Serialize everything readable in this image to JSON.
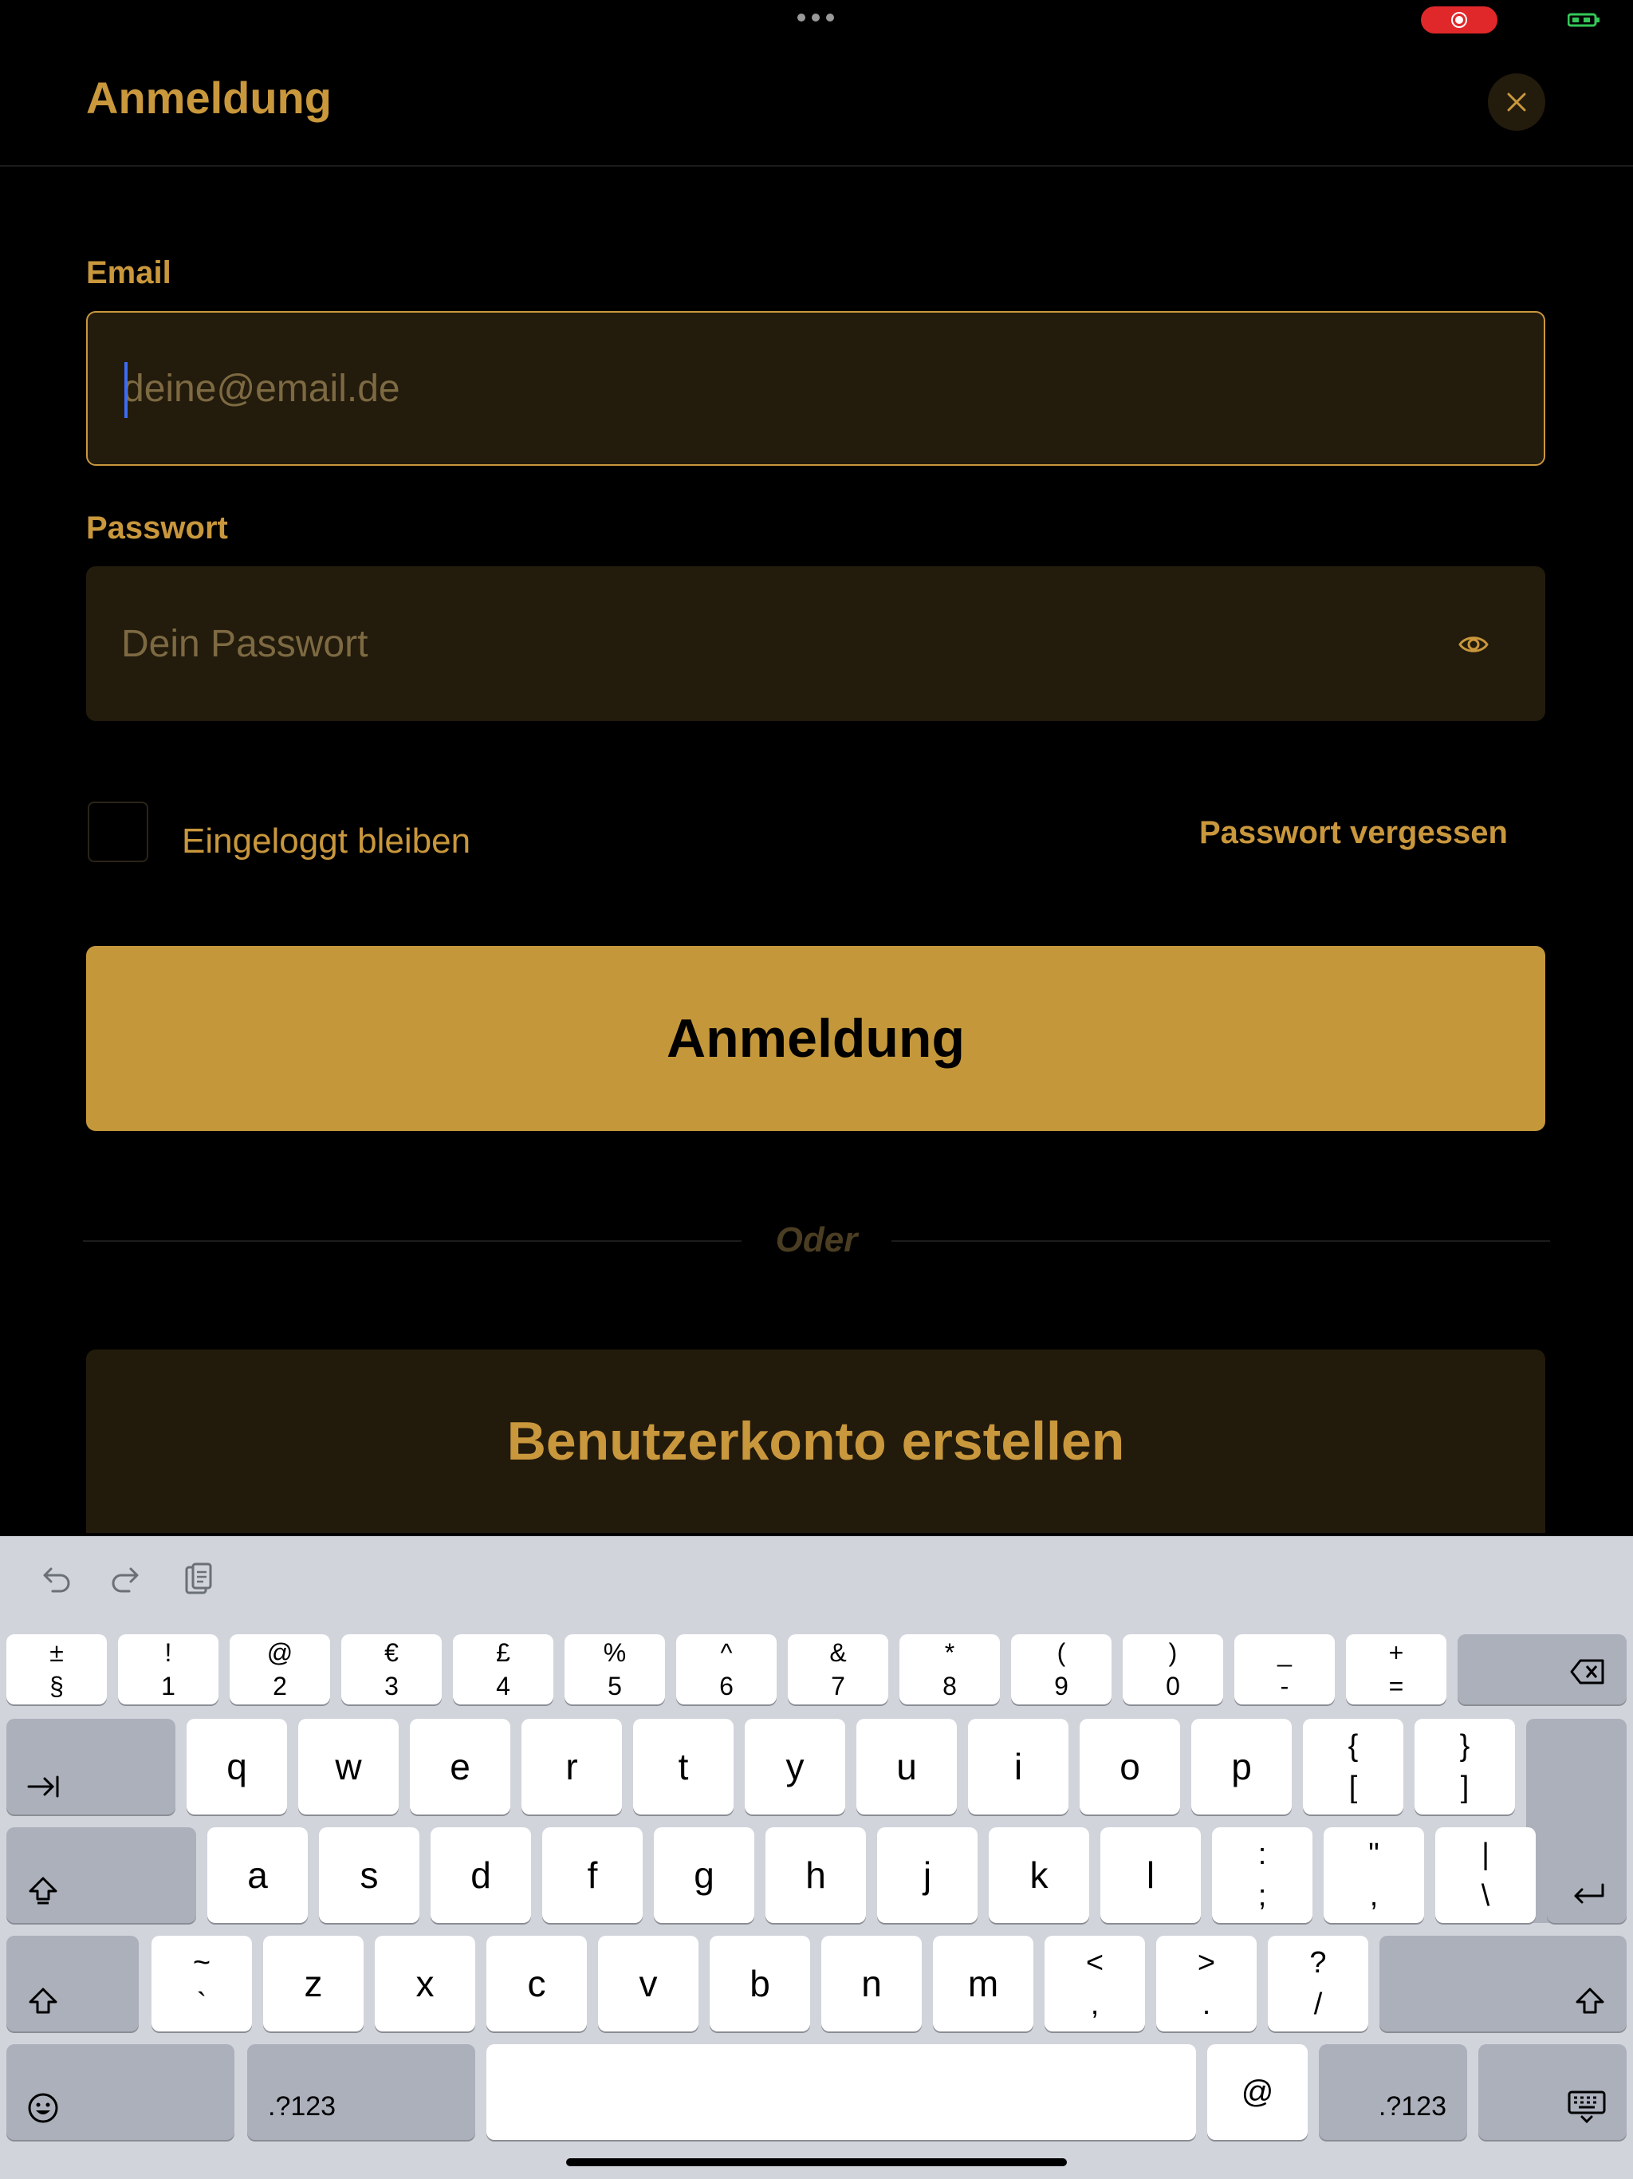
{
  "header": {
    "title": "Anmeldung"
  },
  "form": {
    "email_label": "Email",
    "email_placeholder": "deine@email.de",
    "password_label": "Passwort",
    "password_placeholder": "Dein Passwort",
    "remember_label": "Eingeloggt bleiben",
    "forgot_label": "Passwort vergessen",
    "login_button": "Anmeldung",
    "or_text": "Oder",
    "create_account_button": "Benutzerkonto erstellen"
  },
  "colors": {
    "accent": "#c9973c",
    "button_fill": "#c4973a",
    "field_bg": "#231b0c",
    "background": "#000000",
    "record_indicator": "#e0282a"
  },
  "keyboard": {
    "row1": [
      {
        "top": "±",
        "bottom": "§"
      },
      {
        "top": "!",
        "bottom": "1"
      },
      {
        "top": "@",
        "bottom": "2"
      },
      {
        "top": "€",
        "bottom": "3"
      },
      {
        "top": "£",
        "bottom": "4"
      },
      {
        "top": "%",
        "bottom": "5"
      },
      {
        "top": "^",
        "bottom": "6"
      },
      {
        "top": "&",
        "bottom": "7"
      },
      {
        "top": "*",
        "bottom": "8"
      },
      {
        "top": "(",
        "bottom": "9"
      },
      {
        "top": ")",
        "bottom": "0"
      },
      {
        "top": "_",
        "bottom": "-"
      },
      {
        "top": "+",
        "bottom": "="
      }
    ],
    "row2": [
      "q",
      "w",
      "e",
      "r",
      "t",
      "y",
      "u",
      "i",
      "o",
      "p"
    ],
    "row2_extra": [
      {
        "top": "{",
        "bottom": "["
      },
      {
        "top": "}",
        "bottom": "]"
      }
    ],
    "row3": [
      "a",
      "s",
      "d",
      "f",
      "g",
      "h",
      "j",
      "k",
      "l"
    ],
    "row3_extra": [
      {
        "top": ":",
        "bottom": ";"
      },
      {
        "top": "\"",
        "bottom": ","
      },
      {
        "top": "|",
        "bottom": "\\"
      }
    ],
    "row4_extra_left": {
      "top": "~",
      "bottom": "`"
    },
    "row4": [
      "z",
      "x",
      "c",
      "v",
      "b",
      "n",
      "m"
    ],
    "row4_extra": [
      {
        "top": "<",
        "bottom": ","
      },
      {
        "top": ">",
        "bottom": "."
      },
      {
        "top": "?",
        "bottom": "/"
      }
    ],
    "numbers_label": ".?123",
    "at_key": "@"
  }
}
